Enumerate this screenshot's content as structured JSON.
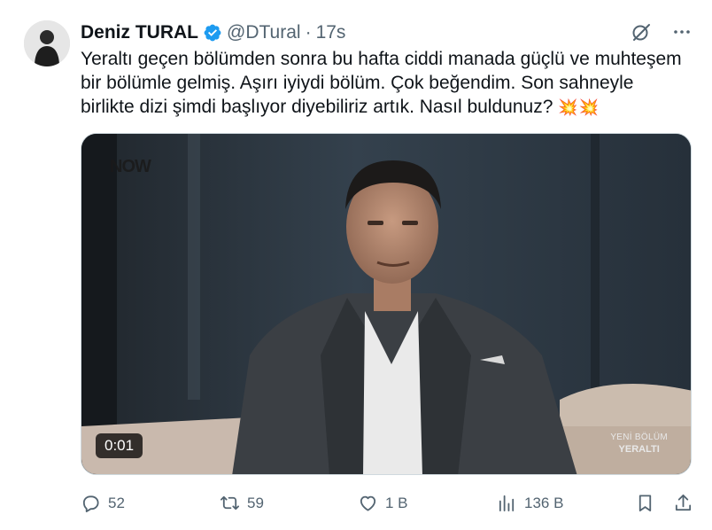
{
  "author": {
    "display_name": "Deniz TURAL",
    "handle": "@DTural",
    "separator": "·",
    "time": "17s",
    "verified": true
  },
  "tweet": {
    "text": "Yeraltı geçen bölümden sonra bu hafta ciddi manada güçlü ve muhteşem bir bölümle gelmiş. Aşırı iyiydi bölüm. Çok beğendim. Son sahneyle birlikte dizi şimdi başlıyor diyebiliriz artık. Nasıl buldunuz?",
    "emoji": "💥💥"
  },
  "media": {
    "type": "video",
    "duration": "0:01",
    "watermark": "NOW",
    "overlay_line1": "YENİ BÖLÜM",
    "overlay_line2": "YERALTI"
  },
  "actions": {
    "replies": "52",
    "reposts": "59",
    "likes": "1 B",
    "views": "136 B"
  },
  "icons": {
    "verified": "verified-badge-icon",
    "grok": "grok-icon",
    "more": "more-icon",
    "reply": "reply-icon",
    "repost": "repost-icon",
    "like": "heart-icon",
    "views": "analytics-icon",
    "bookmark": "bookmark-icon",
    "share": "share-icon"
  },
  "colors": {
    "text": "#0f1419",
    "secondary": "#536471",
    "verified": "#1d9bf0"
  }
}
